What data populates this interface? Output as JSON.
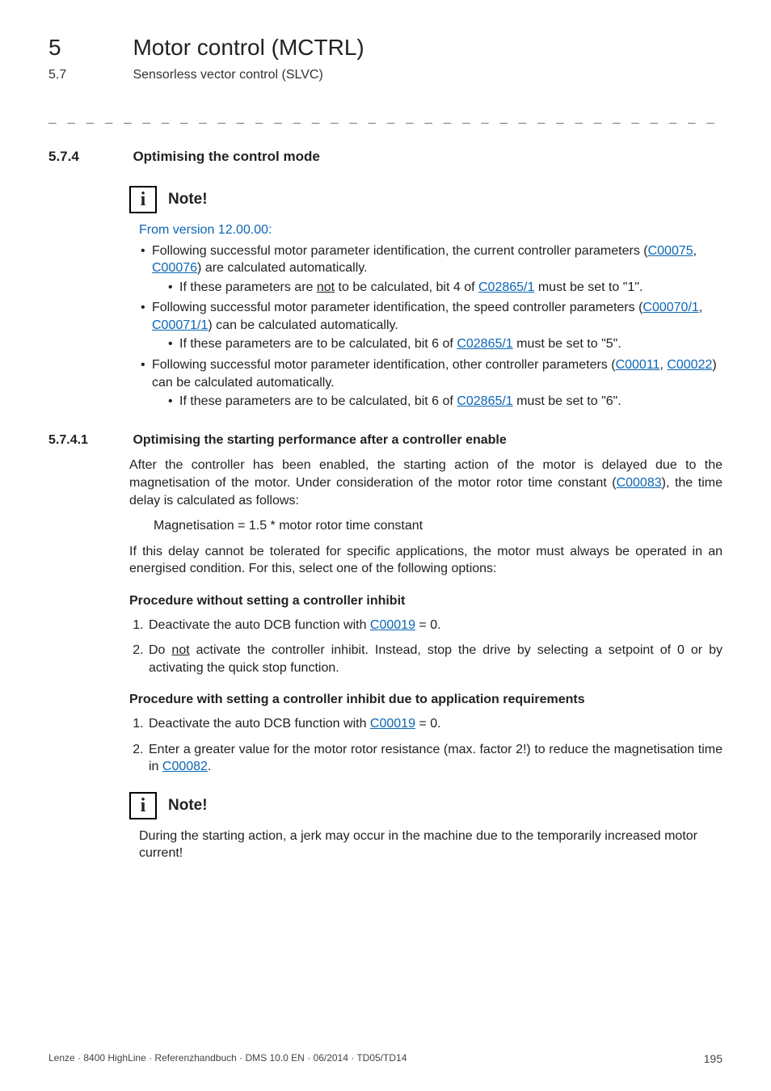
{
  "chapter": {
    "num": "5",
    "title": "Motor control (MCTRL)"
  },
  "subchapter": {
    "num": "5.7",
    "title": "Sensorless vector control (SLVC)"
  },
  "dashline": "_ _ _ _ _ _ _ _ _ _ _ _ _ _ _ _ _ _ _ _ _ _ _ _ _ _ _ _ _ _ _ _ _ _ _ _ _ _ _ _ _ _ _ _ _ _ _ _ _ _ _ _ _ _ _ _ _ _ _ _ _ _ _ _",
  "sec574": {
    "num": "5.7.4",
    "title": "Optimising the control mode"
  },
  "note1": {
    "label": "Note!",
    "lead": "From version 12.00.00:",
    "b1a": "Following successful motor parameter identification, the current controller parameters (",
    "b1l1": "C00075",
    "b1comma": ", ",
    "b1l2": "C00076",
    "b1b": ") are calculated automatically.",
    "b1s1a": "If these parameters are ",
    "b1s1not": "not",
    "b1s1b": " to be calculated, bit 4 of ",
    "b1s1l": "C02865/1",
    "b1s1c": " must be set to \"1\".",
    "b2a": "Following successful motor parameter identification, the speed controller parameters (",
    "b2l1": "C00070/1",
    "b2comma": ", ",
    "b2l2": "C00071/1",
    "b2b": ") can be calculated automatically.",
    "b2s1a": "If these parameters are to be calculated, bit 6 of ",
    "b2s1l": "C02865/1",
    "b2s1b": " must be set to \"5\".",
    "b3a": "Following successful motor parameter identification, other controller parameters (",
    "b3l1": "C00011",
    "b3comma": ", ",
    "b3l2": "C00022",
    "b3b": ") can be calculated automatically.",
    "b3s1a": "If these parameters are to be calculated, bit 6 of ",
    "b3s1l": "C02865/1",
    "b3s1b": " must be set to \"6\"."
  },
  "sec5741": {
    "num": "5.7.4.1",
    "title": "Optimising the starting performance after a controller enable",
    "p1a": "After the controller has been enabled, the starting action of the motor is delayed due to the magnetisation of the motor. Under consideration of the motor rotor time constant (",
    "p1l": "C00083",
    "p1b": "), the time delay is calculated as follows:",
    "formula": "Magnetisation = 1.5 * motor rotor time constant",
    "p2": "If this delay cannot be tolerated for specific applications, the motor must always be operated in an energised condition. For this, select one of the following options:"
  },
  "procA": {
    "head": "Procedure without setting a controller inhibit",
    "s1a": "Deactivate the auto DCB function with ",
    "s1l": "C00019",
    "s1b": " = 0.",
    "s2a": "Do ",
    "s2not": "not",
    "s2b": " activate the controller inhibit. Instead, stop the drive by selecting a setpoint of 0 or by activating the quick stop function."
  },
  "procB": {
    "head": "Procedure with setting a controller inhibit due to application requirements",
    "s1a": "Deactivate the auto DCB function with ",
    "s1l": "C00019",
    "s1b": " = 0.",
    "s2a": "Enter a greater value for the motor rotor resistance (max. factor 2!) to reduce the magnetisation time in ",
    "s2l": "C00082",
    "s2b": "."
  },
  "note2": {
    "label": "Note!",
    "text": "During the starting action, a jerk may occur in the machine due to the temporarily increased motor current!"
  },
  "footer": {
    "left": "Lenze · 8400 HighLine · Referenzhandbuch · DMS 10.0 EN · 06/2014 · TD05/TD14",
    "page": "195"
  },
  "icon": "i"
}
